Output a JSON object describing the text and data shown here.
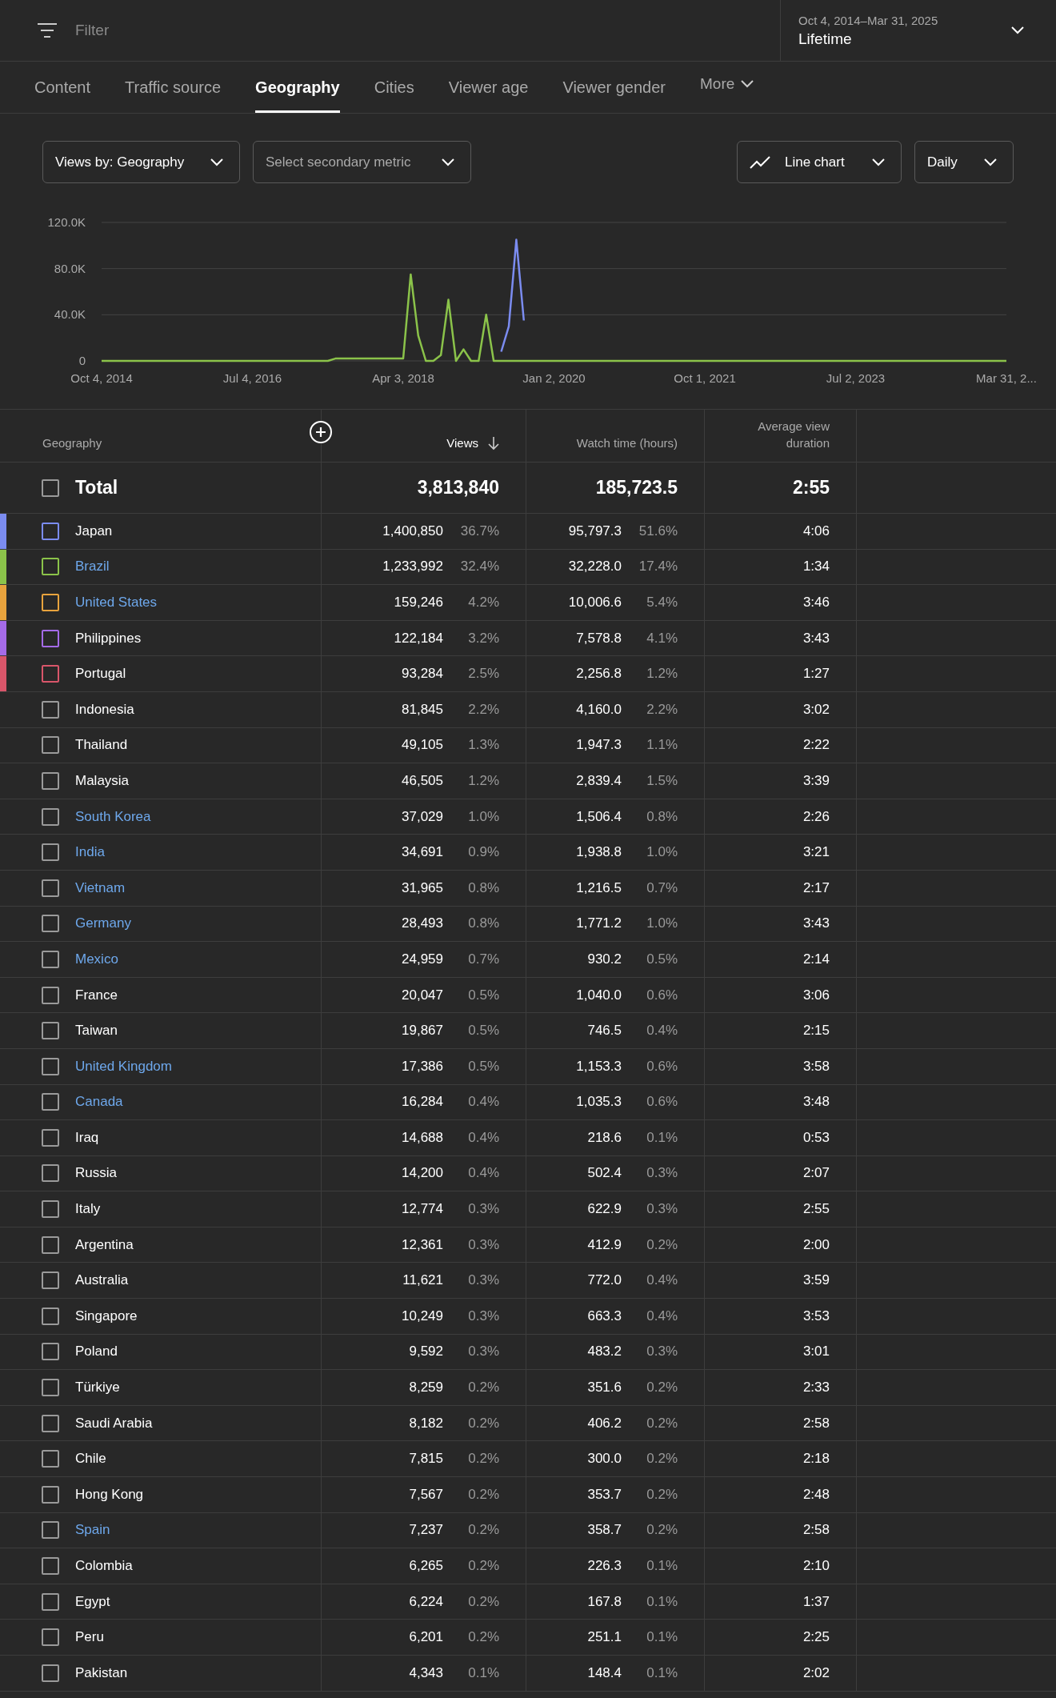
{
  "filter": {
    "placeholder": "Filter"
  },
  "date_range": {
    "range": "Oct 4, 2014–Mar 31, 2025",
    "period": "Lifetime"
  },
  "tabs": [
    {
      "label": "Content",
      "selected": false
    },
    {
      "label": "Traffic source",
      "selected": false
    },
    {
      "label": "Geography",
      "selected": true
    },
    {
      "label": "Cities",
      "selected": false
    },
    {
      "label": "Viewer age",
      "selected": false
    },
    {
      "label": "Viewer gender",
      "selected": false
    }
  ],
  "more_tab": "More",
  "controls": {
    "metric": "Views by: Geography",
    "secondary": {
      "placeholder": "Select secondary metric"
    },
    "chart_type": "Line chart",
    "interval": "Daily"
  },
  "chart_data": {
    "type": "line",
    "categories": [
      "Oct 4, 2014",
      null,
      null,
      null,
      null,
      null,
      null,
      null,
      null,
      null,
      null,
      null,
      null,
      null,
      null,
      null,
      null,
      null,
      null,
      null,
      "Jul 4, 2016",
      null,
      null,
      null,
      null,
      null,
      null,
      null,
      null,
      null,
      null,
      null,
      null,
      null,
      null,
      null,
      null,
      null,
      null,
      null,
      "Apr 3, 2018",
      null,
      null,
      null,
      null,
      null,
      null,
      null,
      null,
      null,
      null,
      null,
      null,
      null,
      null,
      null,
      null,
      null,
      null,
      null,
      "Jan 2, 2020",
      null,
      null,
      null,
      null,
      null,
      null,
      null,
      null,
      null,
      null,
      null,
      null,
      null,
      null,
      null,
      null,
      null,
      null,
      null,
      "Oct 1, 2021",
      null,
      null,
      null,
      null,
      null,
      null,
      null,
      null,
      null,
      null,
      null,
      null,
      null,
      null,
      null,
      null,
      null,
      null,
      null,
      "Jul 2, 2023",
      null,
      null,
      null,
      null,
      null,
      null,
      null,
      null,
      null,
      null,
      null,
      null,
      null,
      null,
      null,
      null,
      null,
      null,
      null,
      "Mar 31, 2..."
    ],
    "series": [
      {
        "color": "#8bc34a",
        "values": [
          0,
          0,
          0,
          0,
          0,
          0,
          0,
          0,
          0,
          0,
          0,
          0,
          0,
          0,
          0,
          0,
          0,
          0,
          0,
          0,
          0,
          0,
          0,
          0,
          0,
          0,
          0,
          0,
          0,
          0,
          0,
          2000,
          2000,
          2000,
          2000,
          2000,
          2000,
          2000,
          2000,
          2000,
          2000,
          75000,
          22000,
          0,
          0,
          5000,
          53000,
          0,
          10000,
          0,
          0,
          40000,
          0,
          0,
          0,
          0,
          0,
          0,
          0,
          0,
          0,
          0,
          0,
          0,
          0,
          0,
          0,
          0,
          0,
          0,
          0,
          0,
          0,
          0,
          0,
          0,
          0,
          0,
          0,
          0,
          0,
          0,
          0,
          0,
          0,
          0,
          0,
          0,
          0,
          0,
          0,
          0,
          0,
          0,
          0,
          0,
          0,
          0,
          0,
          0,
          0,
          0,
          0,
          0,
          0,
          0,
          0,
          0,
          0,
          0,
          0,
          0,
          0,
          0,
          0,
          0,
          0,
          0,
          0,
          0,
          0
        ]
      },
      {
        "color": "#7b8cf0",
        "values": [
          null,
          null,
          null,
          null,
          null,
          null,
          null,
          null,
          null,
          null,
          null,
          null,
          null,
          null,
          null,
          null,
          null,
          null,
          null,
          null,
          null,
          null,
          null,
          null,
          null,
          null,
          null,
          null,
          null,
          null,
          null,
          null,
          null,
          null,
          null,
          null,
          null,
          null,
          null,
          null,
          null,
          null,
          null,
          null,
          null,
          null,
          null,
          null,
          null,
          null,
          null,
          null,
          null,
          8000,
          30000,
          105000,
          35000,
          null,
          null,
          null,
          null,
          null,
          null,
          null,
          null,
          null,
          null,
          null,
          null,
          null,
          null,
          null,
          null,
          null,
          null,
          null,
          null,
          null,
          null,
          null,
          null,
          null,
          null,
          null,
          null,
          null,
          null,
          null,
          null,
          null,
          null,
          null,
          null,
          null,
          null,
          null,
          null,
          null,
          null,
          null,
          null,
          null,
          null,
          null,
          null,
          null,
          null,
          null,
          null,
          null,
          null,
          null,
          null,
          null,
          null,
          null,
          null,
          null,
          null,
          null,
          null
        ]
      }
    ],
    "ylim": [
      0,
      120000
    ],
    "yticks": [
      {
        "value": 0,
        "label": "0"
      },
      {
        "value": 40000,
        "label": "40.0K"
      },
      {
        "value": 80000,
        "label": "80.0K"
      },
      {
        "value": 120000,
        "label": "120.0K"
      }
    ]
  },
  "table": {
    "columns": {
      "geography": "Geography",
      "views": "Views",
      "watch_time": "Watch time (hours)",
      "avg_duration": "Average view duration"
    },
    "total": {
      "label": "Total",
      "checked": false,
      "views": "3,813,840",
      "watch_time": "185,723.5",
      "avg_duration": "2:55"
    },
    "rows": [
      {
        "name": "Japan",
        "checked": false,
        "linked": false,
        "color": "#7b8cf0",
        "views": "1,400,850",
        "views_pct": "36.7%",
        "watch_time": "95,797.3",
        "watch_pct": "51.6%",
        "avg_duration": "4:06"
      },
      {
        "name": "Brazil",
        "checked": false,
        "linked": true,
        "color": "#8bc34a",
        "views": "1,233,992",
        "views_pct": "32.4%",
        "watch_time": "32,228.0",
        "watch_pct": "17.4%",
        "avg_duration": "1:34"
      },
      {
        "name": "United States",
        "checked": false,
        "linked": true,
        "color": "#e8a33d",
        "views": "159,246",
        "views_pct": "4.2%",
        "watch_time": "10,006.6",
        "watch_pct": "5.4%",
        "avg_duration": "3:46"
      },
      {
        "name": "Philippines",
        "checked": false,
        "linked": false,
        "color": "#a56be8",
        "views": "122,184",
        "views_pct": "3.2%",
        "watch_time": "7,578.8",
        "watch_pct": "4.1%",
        "avg_duration": "3:43"
      },
      {
        "name": "Portugal",
        "checked": false,
        "linked": false,
        "color": "#d9566a",
        "views": "93,284",
        "views_pct": "2.5%",
        "watch_time": "2,256.8",
        "watch_pct": "1.2%",
        "avg_duration": "1:27"
      },
      {
        "name": "Indonesia",
        "checked": false,
        "linked": false,
        "views": "81,845",
        "views_pct": "2.2%",
        "watch_time": "4,160.0",
        "watch_pct": "2.2%",
        "avg_duration": "3:02"
      },
      {
        "name": "Thailand",
        "checked": false,
        "linked": false,
        "views": "49,105",
        "views_pct": "1.3%",
        "watch_time": "1,947.3",
        "watch_pct": "1.1%",
        "avg_duration": "2:22"
      },
      {
        "name": "Malaysia",
        "checked": false,
        "linked": false,
        "views": "46,505",
        "views_pct": "1.2%",
        "watch_time": "2,839.4",
        "watch_pct": "1.5%",
        "avg_duration": "3:39"
      },
      {
        "name": "South Korea",
        "checked": false,
        "linked": true,
        "views": "37,029",
        "views_pct": "1.0%",
        "watch_time": "1,506.4",
        "watch_pct": "0.8%",
        "avg_duration": "2:26"
      },
      {
        "name": "India",
        "checked": false,
        "linked": true,
        "views": "34,691",
        "views_pct": "0.9%",
        "watch_time": "1,938.8",
        "watch_pct": "1.0%",
        "avg_duration": "3:21"
      },
      {
        "name": "Vietnam",
        "checked": false,
        "linked": true,
        "views": "31,965",
        "views_pct": "0.8%",
        "watch_time": "1,216.5",
        "watch_pct": "0.7%",
        "avg_duration": "2:17"
      },
      {
        "name": "Germany",
        "checked": false,
        "linked": true,
        "views": "28,493",
        "views_pct": "0.8%",
        "watch_time": "1,771.2",
        "watch_pct": "1.0%",
        "avg_duration": "3:43"
      },
      {
        "name": "Mexico",
        "checked": false,
        "linked": true,
        "views": "24,959",
        "views_pct": "0.7%",
        "watch_time": "930.2",
        "watch_pct": "0.5%",
        "avg_duration": "2:14"
      },
      {
        "name": "France",
        "checked": false,
        "linked": false,
        "views": "20,047",
        "views_pct": "0.5%",
        "watch_time": "1,040.0",
        "watch_pct": "0.6%",
        "avg_duration": "3:06"
      },
      {
        "name": "Taiwan",
        "checked": false,
        "linked": false,
        "views": "19,867",
        "views_pct": "0.5%",
        "watch_time": "746.5",
        "watch_pct": "0.4%",
        "avg_duration": "2:15"
      },
      {
        "name": "United Kingdom",
        "checked": false,
        "linked": true,
        "views": "17,386",
        "views_pct": "0.5%",
        "watch_time": "1,153.3",
        "watch_pct": "0.6%",
        "avg_duration": "3:58"
      },
      {
        "name": "Canada",
        "checked": false,
        "linked": true,
        "views": "16,284",
        "views_pct": "0.4%",
        "watch_time": "1,035.3",
        "watch_pct": "0.6%",
        "avg_duration": "3:48"
      },
      {
        "name": "Iraq",
        "checked": false,
        "linked": false,
        "views": "14,688",
        "views_pct": "0.4%",
        "watch_time": "218.6",
        "watch_pct": "0.1%",
        "avg_duration": "0:53"
      },
      {
        "name": "Russia",
        "checked": false,
        "linked": false,
        "views": "14,200",
        "views_pct": "0.4%",
        "watch_time": "502.4",
        "watch_pct": "0.3%",
        "avg_duration": "2:07"
      },
      {
        "name": "Italy",
        "checked": false,
        "linked": false,
        "views": "12,774",
        "views_pct": "0.3%",
        "watch_time": "622.9",
        "watch_pct": "0.3%",
        "avg_duration": "2:55"
      },
      {
        "name": "Argentina",
        "checked": false,
        "linked": false,
        "views": "12,361",
        "views_pct": "0.3%",
        "watch_time": "412.9",
        "watch_pct": "0.2%",
        "avg_duration": "2:00"
      },
      {
        "name": "Australia",
        "checked": false,
        "linked": false,
        "views": "11,621",
        "views_pct": "0.3%",
        "watch_time": "772.0",
        "watch_pct": "0.4%",
        "avg_duration": "3:59"
      },
      {
        "name": "Singapore",
        "checked": false,
        "linked": false,
        "views": "10,249",
        "views_pct": "0.3%",
        "watch_time": "663.3",
        "watch_pct": "0.4%",
        "avg_duration": "3:53"
      },
      {
        "name": "Poland",
        "checked": false,
        "linked": false,
        "views": "9,592",
        "views_pct": "0.3%",
        "watch_time": "483.2",
        "watch_pct": "0.3%",
        "avg_duration": "3:01"
      },
      {
        "name": "Türkiye",
        "checked": false,
        "linked": false,
        "views": "8,259",
        "views_pct": "0.2%",
        "watch_time": "351.6",
        "watch_pct": "0.2%",
        "avg_duration": "2:33"
      },
      {
        "name": "Saudi Arabia",
        "checked": false,
        "linked": false,
        "views": "8,182",
        "views_pct": "0.2%",
        "watch_time": "406.2",
        "watch_pct": "0.2%",
        "avg_duration": "2:58"
      },
      {
        "name": "Chile",
        "checked": false,
        "linked": false,
        "views": "7,815",
        "views_pct": "0.2%",
        "watch_time": "300.0",
        "watch_pct": "0.2%",
        "avg_duration": "2:18"
      },
      {
        "name": "Hong Kong",
        "checked": false,
        "linked": false,
        "views": "7,567",
        "views_pct": "0.2%",
        "watch_time": "353.7",
        "watch_pct": "0.2%",
        "avg_duration": "2:48"
      },
      {
        "name": "Spain",
        "checked": false,
        "linked": true,
        "views": "7,237",
        "views_pct": "0.2%",
        "watch_time": "358.7",
        "watch_pct": "0.2%",
        "avg_duration": "2:58"
      },
      {
        "name": "Colombia",
        "checked": false,
        "linked": false,
        "views": "6,265",
        "views_pct": "0.2%",
        "watch_time": "226.3",
        "watch_pct": "0.1%",
        "avg_duration": "2:10"
      },
      {
        "name": "Egypt",
        "checked": false,
        "linked": false,
        "views": "6,224",
        "views_pct": "0.2%",
        "watch_time": "167.8",
        "watch_pct": "0.1%",
        "avg_duration": "1:37"
      },
      {
        "name": "Peru",
        "checked": false,
        "linked": false,
        "views": "6,201",
        "views_pct": "0.2%",
        "watch_time": "251.1",
        "watch_pct": "0.1%",
        "avg_duration": "2:25"
      },
      {
        "name": "Pakistan",
        "checked": false,
        "linked": false,
        "views": "4,343",
        "views_pct": "0.1%",
        "watch_time": "148.4",
        "watch_pct": "0.1%",
        "avg_duration": "2:02"
      }
    ]
  }
}
